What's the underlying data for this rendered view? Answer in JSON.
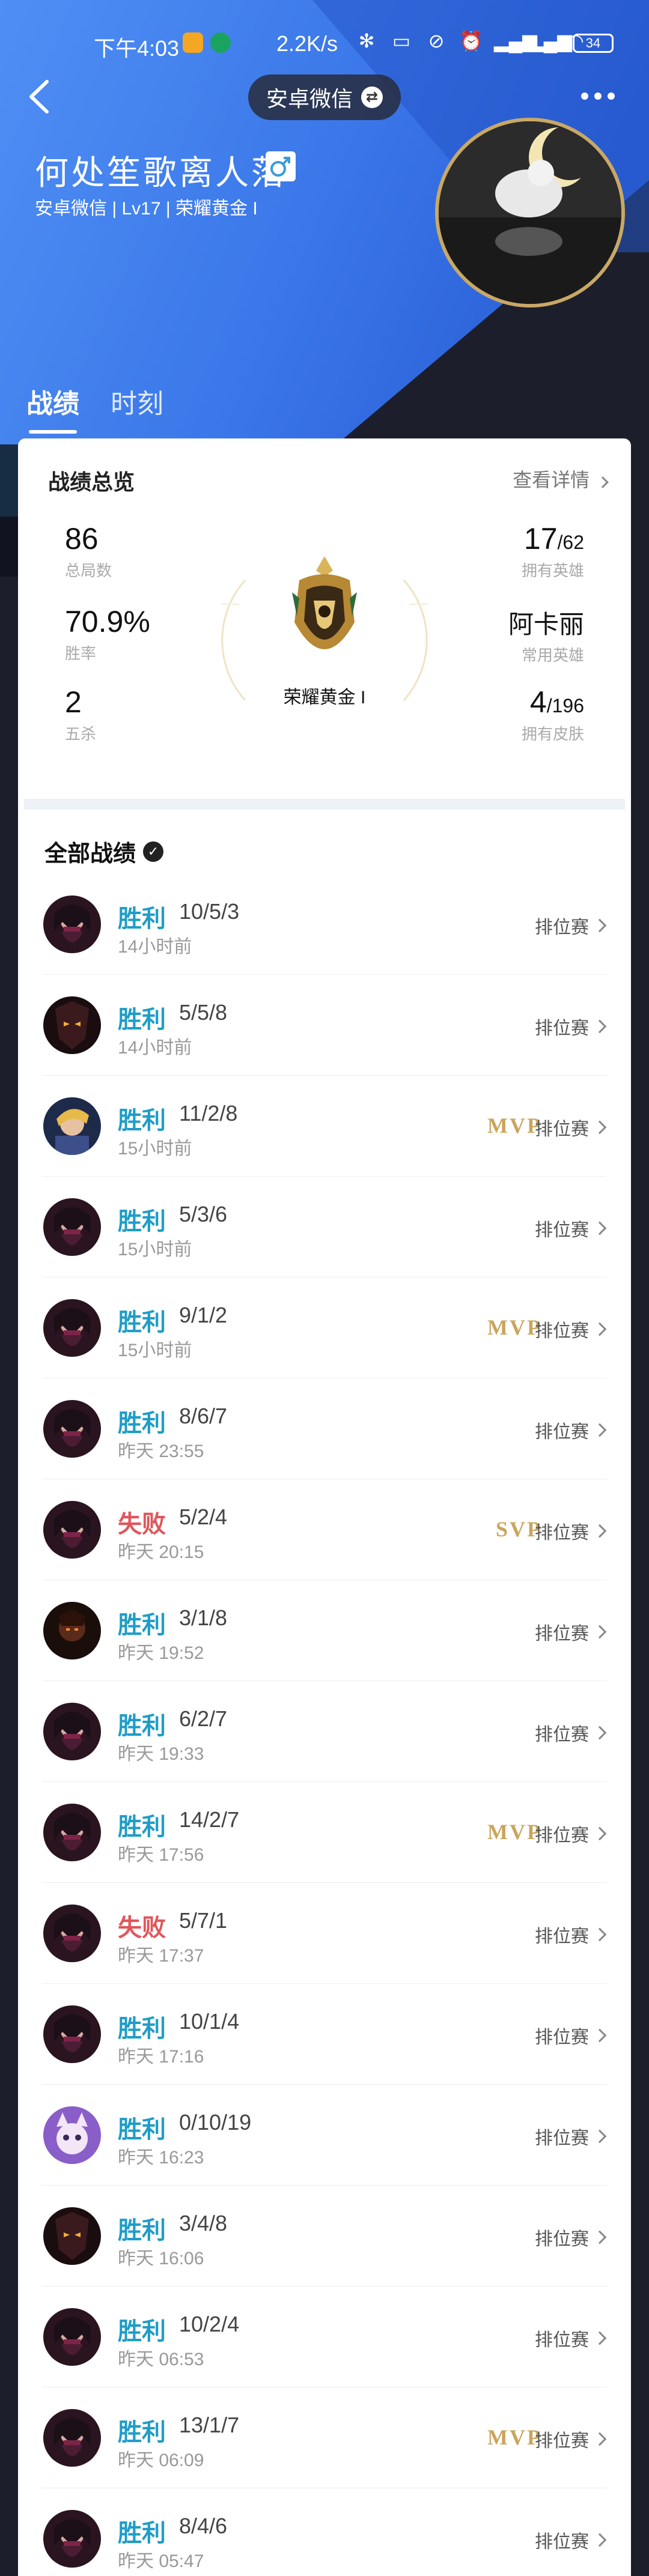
{
  "status_bar": {
    "time": "下午4:03",
    "network_speed": "2.2K/s",
    "battery": "34"
  },
  "nav": {
    "account_label": "安卓微信"
  },
  "profile": {
    "nickname": "何处笙歌离人落",
    "meta": "安卓微信 | Lv17 | 荣耀黄金 I"
  },
  "tabs": [
    {
      "label": "战绩",
      "active": true
    },
    {
      "label": "时刻",
      "active": false
    }
  ],
  "overview": {
    "title": "战绩总览",
    "detail_link": "查看详情",
    "total_games": {
      "value": "86",
      "label": "总局数"
    },
    "win_rate": {
      "value": "70.9%",
      "label": "胜率"
    },
    "pentakills": {
      "value": "2",
      "label": "五杀"
    },
    "heroes_owned": {
      "value": "17",
      "total": "/62",
      "label": "拥有英雄"
    },
    "common_hero": {
      "value": "阿卡丽",
      "label": "常用英雄"
    },
    "skins_owned": {
      "value": "4",
      "total": "/196",
      "label": "拥有皮肤"
    },
    "rank_name": "荣耀黄金 I"
  },
  "all_matches": {
    "title": "全部战绩",
    "items": [
      {
        "result": "胜利",
        "outcome": "win",
        "kda": "10/5/3",
        "time": "14小时前",
        "badge": "",
        "mode": "排位赛",
        "hero": "akali"
      },
      {
        "result": "胜利",
        "outcome": "win",
        "kda": "5/5/8",
        "time": "14小时前",
        "badge": "",
        "mode": "排位赛",
        "hero": "kayn"
      },
      {
        "result": "胜利",
        "outcome": "win",
        "kda": "11/2/8",
        "time": "15小时前",
        "badge": "MVP",
        "mode": "排位赛",
        "hero": "ezreal"
      },
      {
        "result": "胜利",
        "outcome": "win",
        "kda": "5/3/6",
        "time": "15小时前",
        "badge": "",
        "mode": "排位赛",
        "hero": "akali"
      },
      {
        "result": "胜利",
        "outcome": "win",
        "kda": "9/1/2",
        "time": "15小时前",
        "badge": "MVP",
        "mode": "排位赛",
        "hero": "akali"
      },
      {
        "result": "胜利",
        "outcome": "win",
        "kda": "8/6/7",
        "time": "昨天 23:55",
        "badge": "",
        "mode": "排位赛",
        "hero": "akali"
      },
      {
        "result": "失败",
        "outcome": "lose",
        "kda": "5/2/4",
        "time": "昨天 20:15",
        "badge": "SVP",
        "mode": "排位赛",
        "hero": "akali"
      },
      {
        "result": "胜利",
        "outcome": "win",
        "kda": "3/1/8",
        "time": "昨天 19:52",
        "badge": "",
        "mode": "排位赛",
        "hero": "darkhero"
      },
      {
        "result": "胜利",
        "outcome": "win",
        "kda": "6/2/7",
        "time": "昨天 19:33",
        "badge": "",
        "mode": "排位赛",
        "hero": "akali"
      },
      {
        "result": "胜利",
        "outcome": "win",
        "kda": "14/2/7",
        "time": "昨天 17:56",
        "badge": "MVP",
        "mode": "排位赛",
        "hero": "akali"
      },
      {
        "result": "失败",
        "outcome": "lose",
        "kda": "5/7/1",
        "time": "昨天 17:37",
        "badge": "",
        "mode": "排位赛",
        "hero": "akali"
      },
      {
        "result": "胜利",
        "outcome": "win",
        "kda": "10/1/4",
        "time": "昨天 17:16",
        "badge": "",
        "mode": "排位赛",
        "hero": "akali"
      },
      {
        "result": "胜利",
        "outcome": "win",
        "kda": "0/10/19",
        "time": "昨天 16:23",
        "badge": "",
        "mode": "排位赛",
        "hero": "yuumi"
      },
      {
        "result": "胜利",
        "outcome": "win",
        "kda": "3/4/8",
        "time": "昨天 16:06",
        "badge": "",
        "mode": "排位赛",
        "hero": "kayn"
      },
      {
        "result": "胜利",
        "outcome": "win",
        "kda": "10/2/4",
        "time": "昨天 06:53",
        "badge": "",
        "mode": "排位赛",
        "hero": "akali"
      },
      {
        "result": "胜利",
        "outcome": "win",
        "kda": "13/1/7",
        "time": "昨天 06:09",
        "badge": "MVP",
        "mode": "排位赛",
        "hero": "akali"
      },
      {
        "result": "胜利",
        "outcome": "win",
        "kda": "8/4/6",
        "time": "昨天 05:47",
        "badge": "",
        "mode": "排位赛",
        "hero": "akali"
      }
    ]
  },
  "colors": {
    "win": "#1f9dc7",
    "lose": "#e0565b",
    "badge_gold": "#c9a55d",
    "hero_blue": "#3d7ff0",
    "hero_dark": "#1c1f2b"
  }
}
